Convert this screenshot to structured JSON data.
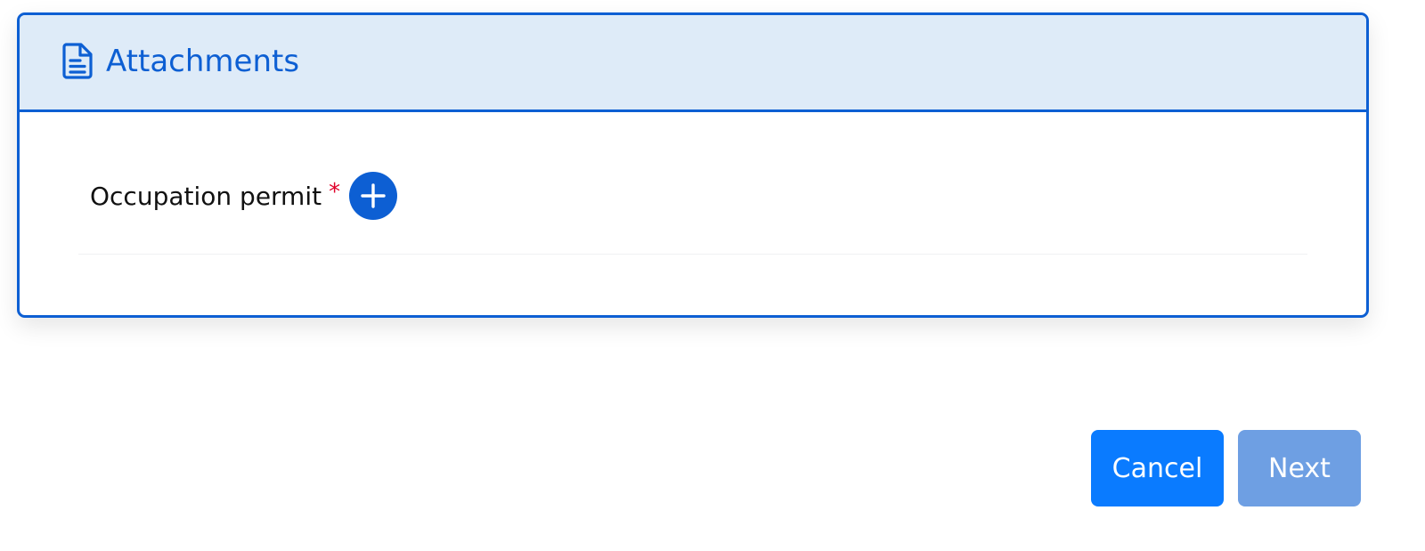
{
  "attachments_panel": {
    "icon": "document-icon",
    "title": "Attachments",
    "fields": [
      {
        "label": "Occupation permit",
        "required_marker": "*",
        "add_icon": "plus-icon"
      }
    ]
  },
  "footer": {
    "cancel_label": "Cancel",
    "next_label": "Next",
    "next_state": "disabled"
  },
  "colors": {
    "primary": "#0d5fd3",
    "header_bg": "#deebf8",
    "required": "#e0002a",
    "cancel_bg": "#0a7bff",
    "next_bg_disabled": "#6e9fe3"
  }
}
